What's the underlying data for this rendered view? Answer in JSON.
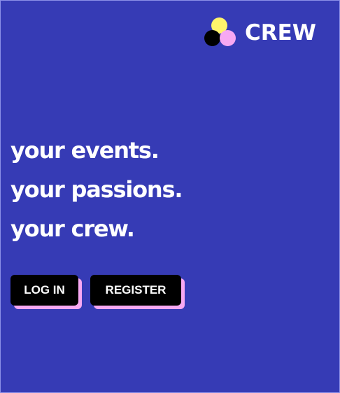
{
  "brand": {
    "name": "CREW",
    "logo_icon": "three-dots-logo-icon",
    "colors": {
      "yellow": "#FFF46B",
      "black": "#000000",
      "pink": "#F7A8F2"
    }
  },
  "hero": {
    "lines": [
      "your events.",
      "your passions.",
      "your crew."
    ]
  },
  "actions": {
    "login_label": "LOG IN",
    "register_label": "REGISTER"
  },
  "theme": {
    "background": "#363BB5",
    "text": "#FFFFFF",
    "button_bg": "#000000",
    "button_shadow": "#F7A8F2"
  }
}
